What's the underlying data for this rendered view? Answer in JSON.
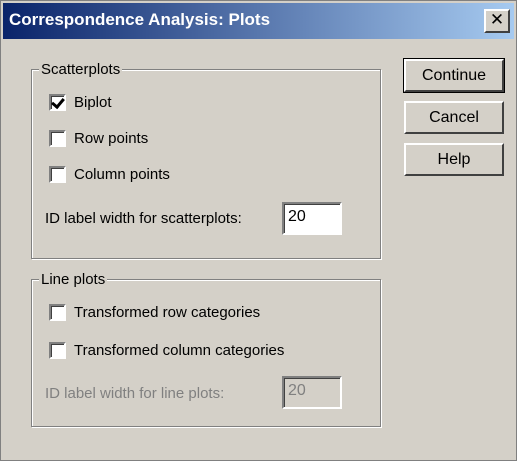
{
  "window": {
    "title": "Correspondence Analysis: Plots",
    "close_glyph": "✕"
  },
  "scatterplots": {
    "group_label": "Scatterplots",
    "biplot": {
      "label": "Biplot",
      "checked": true
    },
    "row_points": {
      "label": "Row points",
      "checked": false
    },
    "column_points": {
      "label": "Column points",
      "checked": false
    },
    "id_label": "ID label width for scatterplots:",
    "id_value": "20"
  },
  "line_plots": {
    "group_label": "Line plots",
    "transformed_row": {
      "label": "Transformed row categories",
      "checked": false
    },
    "transformed_column": {
      "label": "Transformed column categories",
      "checked": false
    },
    "id_label": "ID label width for line plots:",
    "id_value": "20"
  },
  "buttons": {
    "continue": "Continue",
    "cancel": "Cancel",
    "help": "Help"
  }
}
